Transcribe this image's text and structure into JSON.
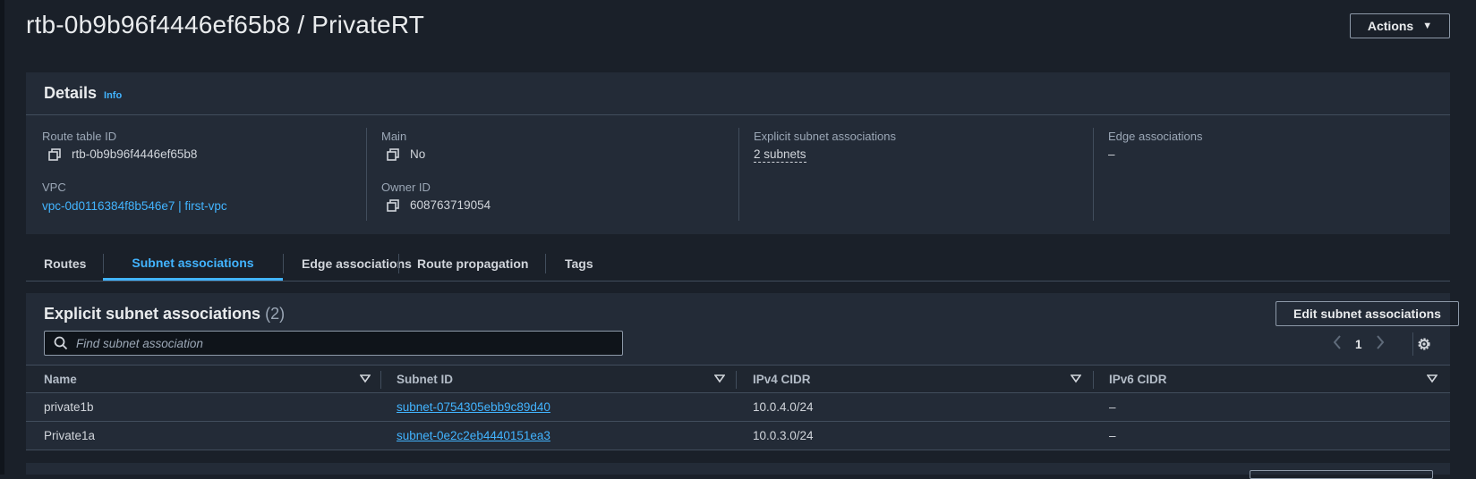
{
  "page": {
    "title": "rtb-0b9b96f4446ef65b8 / PrivateRT",
    "actions_label": "Actions"
  },
  "details": {
    "title": "Details",
    "info": "Info",
    "route_table_id": {
      "label": "Route table ID",
      "value": "rtb-0b9b96f4446ef65b8"
    },
    "vpc": {
      "label": "VPC",
      "value": "vpc-0d0116384f8b546e7 | first-vpc"
    },
    "main": {
      "label": "Main",
      "value": "No"
    },
    "owner_id": {
      "label": "Owner ID",
      "value": "608763719054"
    },
    "explicit_subnet_associations": {
      "label": "Explicit subnet associations",
      "value": "2 subnets"
    },
    "edge_associations": {
      "label": "Edge associations",
      "value": "–"
    }
  },
  "tabs": [
    {
      "label": "Routes",
      "active": false
    },
    {
      "label": "Subnet associations",
      "active": true
    },
    {
      "label": "Edge associations",
      "active": false
    },
    {
      "label": "Route propagation",
      "active": false
    },
    {
      "label": "Tags",
      "active": false
    }
  ],
  "subnet_associations": {
    "title": "Explicit subnet associations",
    "count": "(2)",
    "edit_button": "Edit subnet associations",
    "search_placeholder": "Find subnet association",
    "page": "1",
    "columns": [
      "Name",
      "Subnet ID",
      "IPv4 CIDR",
      "IPv6 CIDR"
    ],
    "rows": [
      {
        "name": "private1b",
        "subnet_id": "subnet-0754305ebb9c89d40",
        "ipv4": "10.0.4.0/24",
        "ipv6": "–"
      },
      {
        "name": "Private1a",
        "subnet_id": "subnet-0e2c2eb4440151ea3",
        "ipv4": "10.0.3.0/24",
        "ipv6": "–"
      }
    ]
  },
  "colors": {
    "background": "#1a2029",
    "panel": "#232b37",
    "link": "#42b4ff",
    "border": "#414d5c"
  },
  "icons": [
    "copy-icon",
    "search-icon",
    "chevron-left-icon",
    "chevron-right-icon",
    "gear-icon",
    "caret-down-icon"
  ]
}
